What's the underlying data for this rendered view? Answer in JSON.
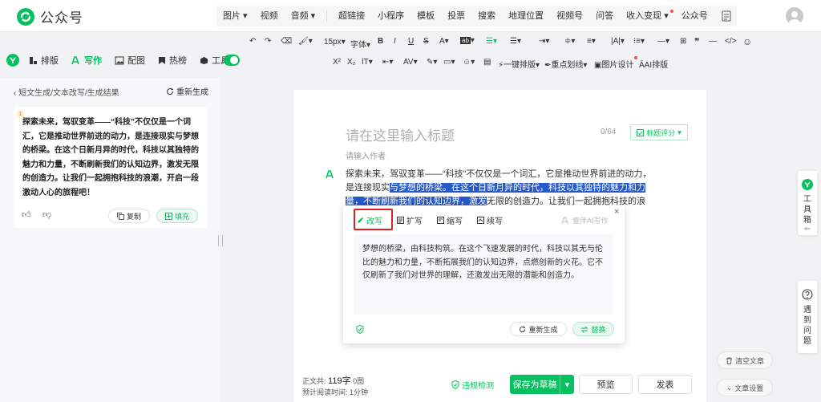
{
  "app": {
    "title": "公众号",
    "brand_color": "#07c160"
  },
  "topmenu": {
    "insert": [
      "图片",
      "视频",
      "音频"
    ],
    "tools": [
      "超链接",
      "小程序",
      "模板",
      "投票",
      "搜索",
      "地理位置",
      "视频号",
      "问答",
      "收入变现",
      "公众号"
    ]
  },
  "sidetabs": [
    "排版",
    "写作",
    "配图",
    "热榜",
    "工具"
  ],
  "format": {
    "fontsize": "15px",
    "font": "字体",
    "bold": "B",
    "italic": "I",
    "underline": "U",
    "strike": "S",
    "row2": [
      "X²",
      "X₂",
      "一键排版",
      "重点划线",
      "图片设计",
      "AI排版"
    ]
  },
  "leftpanel": {
    "breadcrumb": "短文生成/文本改写/生成结果",
    "regenerate": "重新生成",
    "card_badge": "1",
    "card_text": "探索未来，驾驭变革——“科技”不仅仅是一个词汇，它是推动世界前进的动力，是连接现实与梦想的桥梁。在这个日新月异的时代，科技以其独特的魅力和力量，不断刷新我们的认知边界，激发无限的创造力。让我们一起拥抱科技的浪潮，开启一段激动人心的旅程吧！",
    "copy": "复制",
    "fill": "填充"
  },
  "editor": {
    "title_placeholder": "请在这里输入标题",
    "title_count": "0/64",
    "score_label": "标题评分",
    "author_placeholder": "请输入作者",
    "body_pre": "探索未来，驾驭变革——“科技”不仅仅是一个词汇，它是推动世界前进的动力，是连接现实",
    "body_selected": "与梦想的桥梁。在这个日新月异的时代，科技以其独特的魅力和力量，不断刷新我们的认知边界，激发",
    "body_post": "无限的创造力。让我们一起拥抱科技的浪潮，开启一段激动"
  },
  "popup": {
    "tabs": [
      "改写",
      "扩写",
      "缩写",
      "续写"
    ],
    "ai_label": "壹伴AI写作",
    "close": "×",
    "result": "梦想的桥梁，由科技构筑。在这个飞速发展的时代，科技以其无与伦比的魅力和力量，不断拓展我们的认知边界，点燃创新的火花。它不仅刷新了我们对世界的理解，还激发出无限的潜能和创造力。",
    "regenerate": "重新生成",
    "replace": "替换"
  },
  "bottom": {
    "words_label": "正文共:",
    "words_value": "119字",
    "images_value": "0图",
    "read_label": "预计阅读时间:",
    "read_value": "1分钟",
    "violation": "违规检测",
    "save": "保存为草稿",
    "preview": "预览",
    "publish": "发表"
  },
  "right": {
    "clear": "清空文章",
    "settings": "文章设置",
    "toolbox": [
      "工",
      "具",
      "箱"
    ],
    "problem": [
      "遇",
      "到",
      "问",
      "题"
    ]
  }
}
